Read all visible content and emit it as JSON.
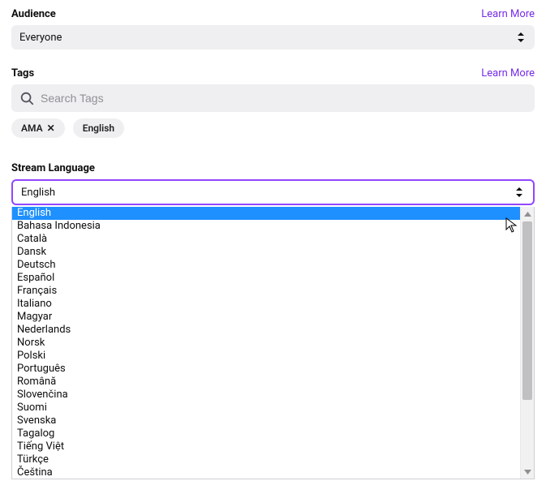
{
  "audience": {
    "label": "Audience",
    "learn_more": "Learn More",
    "value": "Everyone"
  },
  "tags": {
    "label": "Tags",
    "learn_more": "Learn More",
    "placeholder": "Search Tags",
    "items": [
      {
        "label": "AMA",
        "removable": true
      },
      {
        "label": "English",
        "removable": false
      }
    ]
  },
  "stream_language": {
    "label": "Stream Language",
    "value": "English",
    "options": [
      "English",
      "Bahasa Indonesia",
      "Català",
      "Dansk",
      "Deutsch",
      "Español",
      "Français",
      "Italiano",
      "Magyar",
      "Nederlands",
      "Norsk",
      "Polski",
      "Português",
      "Română",
      "Slovenčina",
      "Suomi",
      "Svenska",
      "Tagalog",
      "Tiếng Việt",
      "Türkçe",
      "Čeština"
    ],
    "selected_index": 0
  },
  "colors": {
    "accent": "#9147ff",
    "link": "#772ce8",
    "highlight": "#1e90ff",
    "surface": "#efeff1"
  }
}
